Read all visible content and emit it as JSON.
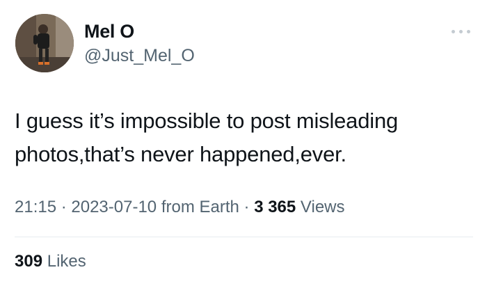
{
  "author": {
    "name": "Mel O",
    "handle": "@Just_Mel_O"
  },
  "tweet": {
    "text_line1": "I guess it’s impossible to post misleading",
    "text_line2": "photos,that’s never happened,ever."
  },
  "meta": {
    "time": "21:15",
    "separator": " · ",
    "date": "2023-07-10",
    "source": " from Earth",
    "views_count": "3 365",
    "views_label": " Views"
  },
  "stats": {
    "likes_count": "309",
    "likes_label": " Likes"
  },
  "icons": {
    "more": "more-horizontal-icon"
  },
  "colors": {
    "text_primary": "#0f1419",
    "text_secondary": "#536471",
    "divider": "#e6ecf0"
  }
}
